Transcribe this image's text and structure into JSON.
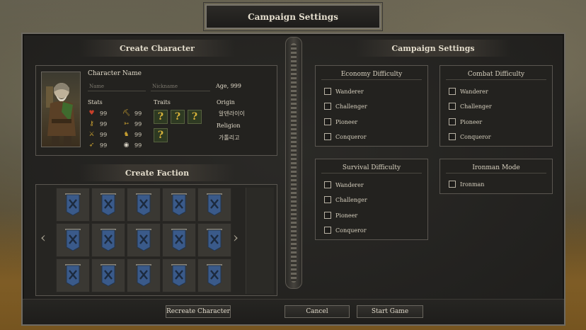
{
  "window_title": "Campaign Settings",
  "left": {
    "create_character_header": "Create Character",
    "character_name_label": "Character Name",
    "name_placeholder": "Name",
    "nickname_placeholder": "Nickname",
    "age_label": "Age, 999",
    "stats_label": "Stats",
    "stats": [
      {
        "icon": "heart-icon",
        "value": "99"
      },
      {
        "icon": "key-icon",
        "value": "99"
      },
      {
        "icon": "crossed-swords-icon",
        "value": "99"
      },
      {
        "icon": "bow-icon",
        "value": "99"
      },
      {
        "icon": "pickaxe-icon",
        "value": "99"
      },
      {
        "icon": "arrow-icon",
        "value": "99"
      },
      {
        "icon": "horse-icon",
        "value": "99"
      },
      {
        "icon": "eye-icon",
        "value": "99"
      }
    ],
    "traits_label": "Traits",
    "traits": [
      "?",
      "?",
      "?",
      "?"
    ],
    "origin_label": "Origin",
    "origin_value": "알덴라이이",
    "religion_label": "Religion",
    "religion_value": "가톨리고",
    "create_faction_header": "Create Faction"
  },
  "right": {
    "campaign_settings_header": "Campaign Settings",
    "economy": {
      "title": "Economy Difficulty",
      "options": [
        "Wanderer",
        "Challenger",
        "Pioneer",
        "Conqueror"
      ]
    },
    "combat": {
      "title": "Combat Difficulty",
      "options": [
        "Wanderer",
        "Challenger",
        "Pioneer",
        "Conqueror"
      ]
    },
    "survival": {
      "title": "Survival Difficulty",
      "options": [
        "Wanderer",
        "Challenger",
        "Pioneer",
        "Conqueror"
      ]
    },
    "ironman": {
      "title": "Ironman Mode",
      "options": [
        "Ironman"
      ]
    }
  },
  "buttons": {
    "recreate": "Recreate Character",
    "cancel": "Cancel",
    "start": "Start Game"
  },
  "colors": {
    "banner_blue": "#3a5a8a",
    "trait_gold": "#d6b13a"
  }
}
